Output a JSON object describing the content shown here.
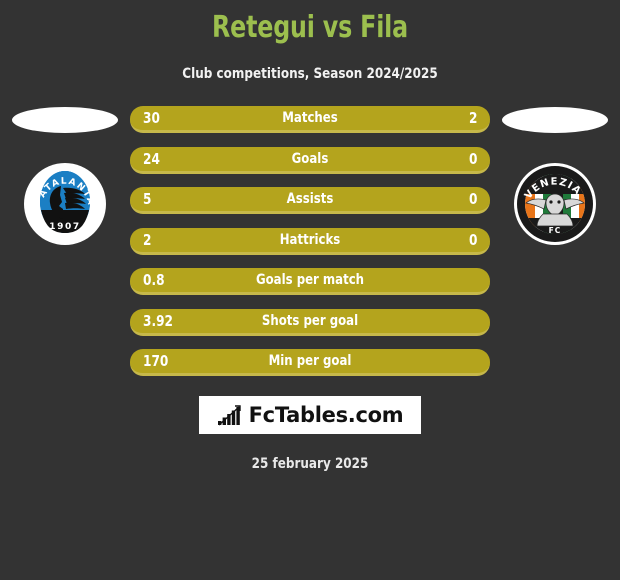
{
  "header": {
    "title": "Retegui vs Fila",
    "subtitle": "Club competitions, Season 2024/2025",
    "title_color": "#9cbf4e"
  },
  "teams": {
    "home": {
      "crest_name": "atalanta-crest",
      "crest_text_top": "ATALANTA",
      "crest_text_bottom": "1907"
    },
    "away": {
      "crest_name": "venezia-crest",
      "crest_text_top": "VENEZIA",
      "crest_text_bottom": "FC"
    }
  },
  "stats": [
    {
      "label": "Matches",
      "home": "30",
      "away": "2"
    },
    {
      "label": "Goals",
      "home": "24",
      "away": "0"
    },
    {
      "label": "Assists",
      "home": "5",
      "away": "0"
    },
    {
      "label": "Hattricks",
      "home": "2",
      "away": "0"
    },
    {
      "label": "Goals per match",
      "home": "0.8",
      "away": ""
    },
    {
      "label": "Shots per goal",
      "home": "3.92",
      "away": ""
    },
    {
      "label": "Min per goal",
      "home": "170",
      "away": ""
    }
  ],
  "footer": {
    "brand": "FcTables.com",
    "brand_icon": "bar-chart-growth-icon",
    "date": "25 february 2025"
  },
  "colors": {
    "background": "#333333",
    "bar": "#b4a41d",
    "bar_edge": "#c6b84a",
    "title": "#9cbf4e",
    "text": "#ffffff"
  }
}
